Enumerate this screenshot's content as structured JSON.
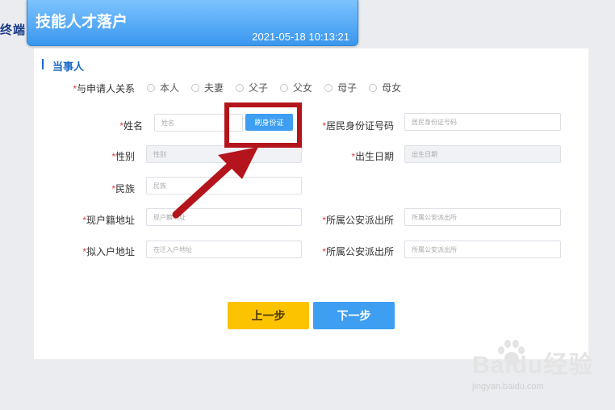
{
  "edge_text": "终端",
  "header": {
    "title": "技能人才落户",
    "datetime": "2021-05-18 10:13:21"
  },
  "section": {
    "title": "当事人"
  },
  "relationship": {
    "label": "与申请人关系",
    "options": [
      "本人",
      "夫妻",
      "父子",
      "父女",
      "母子",
      "母女"
    ]
  },
  "fields": {
    "name": {
      "label": "姓名",
      "placeholder": "姓名"
    },
    "swipe_button": "刷身份证",
    "id_number": {
      "label": "居民身份证号码",
      "placeholder": "居民身份证号码"
    },
    "gender": {
      "label": "性别",
      "placeholder": "性别"
    },
    "birth_date": {
      "label": "出生日期",
      "placeholder": "出生日期"
    },
    "ethnicity": {
      "label": "民族",
      "placeholder": "民族"
    },
    "current_address": {
      "label": "现户籍地址",
      "placeholder": "现户籍地址"
    },
    "police_station_1": {
      "label": "所属公安派出所",
      "placeholder": "所属公安派出所"
    },
    "planned_address": {
      "label": "拟入户地址",
      "placeholder": "在迁入户地址"
    },
    "police_station_2": {
      "label": "所属公安派出所",
      "placeholder": "所属公安派出所"
    }
  },
  "buttons": {
    "prev": "上一步",
    "next": "下一步"
  },
  "required_mark": "*",
  "watermark": {
    "brand": "Baidu经验",
    "url": "jingyan.baidu.com"
  },
  "colors": {
    "header_blue": "#3a97ee",
    "accent_blue": "#3d9ef2",
    "prev_yellow": "#fcc300",
    "required_red": "#e23b3b",
    "annotation_red": "#b4141b"
  }
}
